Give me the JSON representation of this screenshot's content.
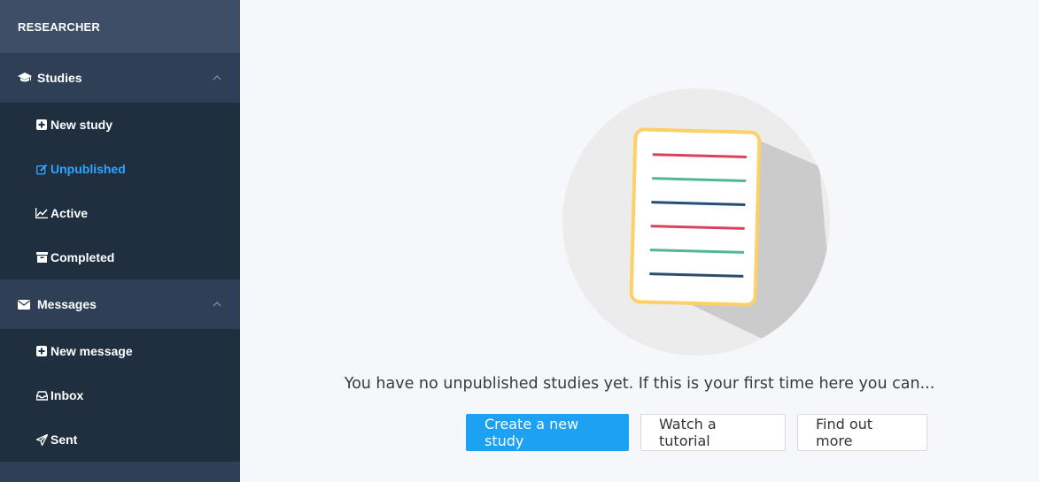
{
  "sidebar": {
    "brand": "RESEARCHER",
    "sections": [
      {
        "label": "Studies",
        "icon": "graduation-cap-icon",
        "items": [
          {
            "label": "New study",
            "icon": "plus-square-icon"
          },
          {
            "label": "Unpublished",
            "icon": "edit-icon",
            "active": true
          },
          {
            "label": "Active",
            "icon": "line-chart-icon"
          },
          {
            "label": "Completed",
            "icon": "archive-icon"
          }
        ]
      },
      {
        "label": "Messages",
        "icon": "envelope-icon",
        "items": [
          {
            "label": "New message",
            "icon": "plus-square-icon"
          },
          {
            "label": "Inbox",
            "icon": "inbox-icon"
          },
          {
            "label": "Sent",
            "icon": "paper-plane-icon"
          }
        ]
      }
    ]
  },
  "main": {
    "empty_message": "You have no unpublished studies yet. If this is your first time here you can...",
    "buttons": {
      "create": "Create a new study",
      "tutorial": "Watch a tutorial",
      "more": "Find out more"
    }
  },
  "colors": {
    "sidebar_bg": "#1f2f40",
    "section_bg": "#2f4056",
    "brand_bg": "#3e4e67",
    "active": "#2aa8ff",
    "primary": "#1da1f2"
  }
}
